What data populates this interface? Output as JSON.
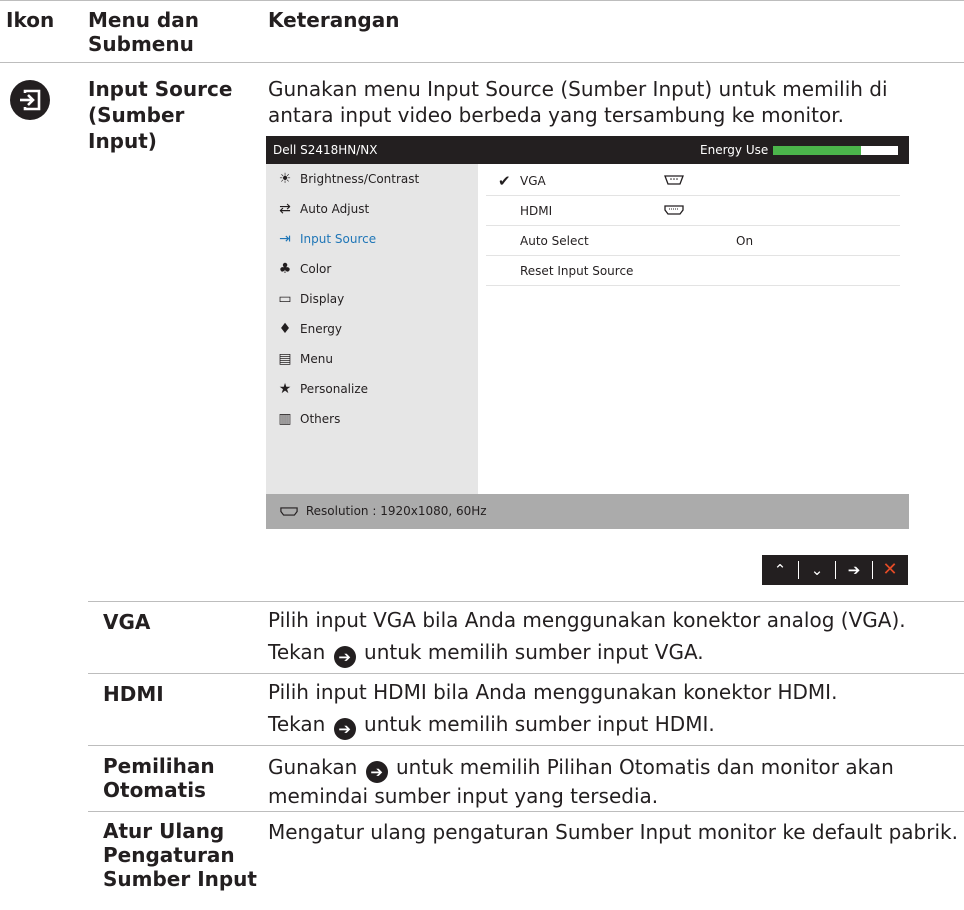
{
  "header": {
    "col_icon": "Ikon",
    "col_menu": "Menu dan Submenu",
    "col_desc": "Keterangan"
  },
  "section": {
    "icon": "input-source-icon",
    "title": "Input Source (Sumber Input)",
    "intro": "Gunakan menu Input Source (Sumber Input) untuk memilih di antara input video berbeda yang tersambung ke monitor."
  },
  "osd": {
    "model": "Dell S2418HN/NX",
    "energy_label": "Energy Use",
    "energy_level": 0.7,
    "menu_items": [
      {
        "label": "Brightness/Contrast",
        "icon": "sun-icon"
      },
      {
        "label": "Auto Adjust",
        "icon": "auto-adjust-icon"
      },
      {
        "label": "Input Source",
        "icon": "input-source-icon"
      },
      {
        "label": "Color",
        "icon": "color-icon"
      },
      {
        "label": "Display",
        "icon": "display-icon"
      },
      {
        "label": "Energy",
        "icon": "energy-icon"
      },
      {
        "label": "Menu",
        "icon": "menu-icon"
      },
      {
        "label": "Personalize",
        "icon": "star-icon"
      },
      {
        "label": "Others",
        "icon": "others-icon"
      }
    ],
    "active_item": "Input Source",
    "submenu": [
      {
        "label": "VGA",
        "checked": true,
        "port": "vga-port-icon",
        "value": ""
      },
      {
        "label": "HDMI",
        "checked": false,
        "port": "hdmi-port-icon",
        "value": ""
      },
      {
        "label": "Auto Select",
        "checked": false,
        "port": "",
        "value": "On"
      },
      {
        "label": "Reset Input Source",
        "checked": false,
        "port": "",
        "value": ""
      }
    ],
    "resolution": "Resolution : 1920x1080, 60Hz"
  },
  "nav_buttons": [
    "up-icon",
    "down-icon",
    "right-arrow-icon",
    "close-icon"
  ],
  "subs": [
    {
      "label": "VGA",
      "line1": "Pilih input VGA bila Anda menggunakan konektor analog (VGA).",
      "line2_pre": "Tekan",
      "line2_post": "untuk memilih sumber input VGA."
    },
    {
      "label": "HDMI",
      "line1": "Pilih input HDMI bila Anda menggunakan konektor HDMI.",
      "line2_pre": "Tekan",
      "line2_post": "untuk memilih sumber input HDMI."
    },
    {
      "label": "Pemilihan Otomatis",
      "line1_pre": "Gunakan",
      "line1_post": "untuk memilih Pilihan Otomatis dan monitor akan",
      "line2": "memindai sumber input yang tersedia."
    },
    {
      "label": "Atur Ulang Pengaturan Sumber Input",
      "text": "Mengatur ulang pengaturan Sumber Input monitor ke default pabrik."
    }
  ]
}
